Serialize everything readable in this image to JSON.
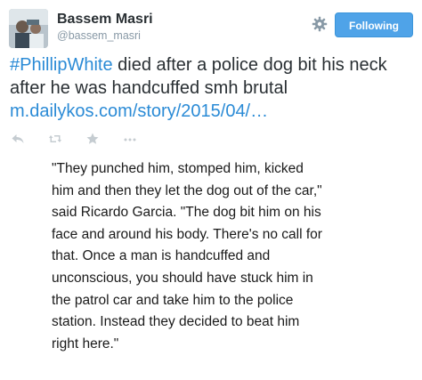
{
  "user": {
    "full_name": "Bassem Masri",
    "username": "@bassem_masri"
  },
  "header": {
    "follow_label": "Following",
    "settings_icon": "gear-icon"
  },
  "tweet": {
    "hashtag": "#PhillipWhite",
    "text_main": " died after a police dog bit his neck after he was handcuffed smh brutal ",
    "link": "m.dailykos.com/story/2015/04/…"
  },
  "actions": {
    "icons": [
      "reply-icon",
      "retweet-icon",
      "favorite-icon",
      "more-icon"
    ]
  },
  "quote": {
    "lines": [
      "\"They punched him, stomped him, kicked",
      "him and then they let the dog out of the car,\"",
      "said Ricardo Garcia. \"The dog bit him on his",
      "face and around his body. There's no call for",
      "that. Once a man is handcuffed and",
      "unconscious, you should have stuck him in",
      "the patrol car and take him to the police",
      "station. Instead they decided to beat him",
      "right here.\""
    ]
  },
  "colors": {
    "link": "#2b8bd6",
    "follow_button": "#4fa3e8",
    "secondary_text": "#8899a6",
    "action_icons": "#c5ccd1"
  }
}
